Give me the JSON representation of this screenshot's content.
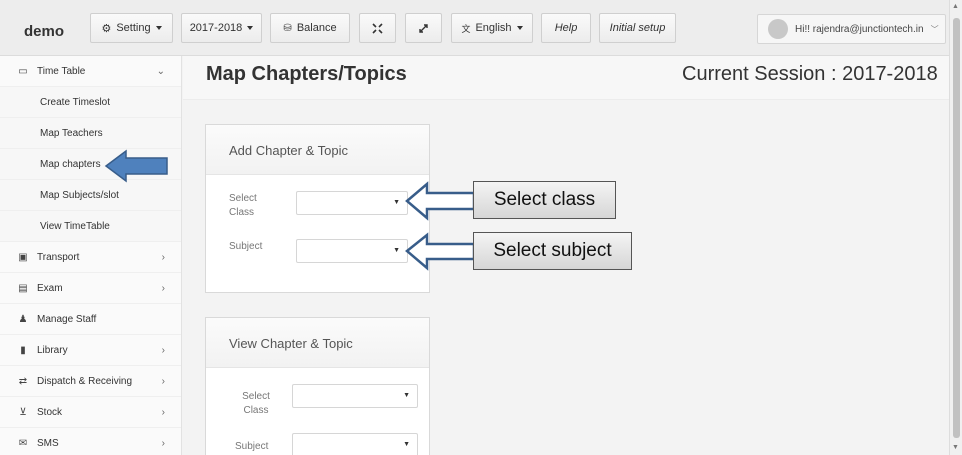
{
  "app": {
    "brand": "demo"
  },
  "toolbar": {
    "setting": "Setting",
    "year": "2017-2018",
    "balance": "Balance",
    "language": "English",
    "help": "Help",
    "initial_setup": "Initial setup",
    "user_greeting": "Hi!! rajendra@junctiontech.in"
  },
  "sidebar": {
    "items": [
      {
        "label": "Time Table",
        "icon": "calendar-icon",
        "expanded": true
      },
      {
        "label": "Create Timeslot"
      },
      {
        "label": "Map Teachers"
      },
      {
        "label": "Map chapters"
      },
      {
        "label": "Map Subjects/slot"
      },
      {
        "label": "View TimeTable"
      },
      {
        "label": "Transport",
        "icon": "bus-icon"
      },
      {
        "label": "Exam",
        "icon": "file-icon"
      },
      {
        "label": "Manage Staff",
        "icon": "users-icon"
      },
      {
        "label": "Library",
        "icon": "book-icon"
      },
      {
        "label": "Dispatch & Receiving",
        "icon": "exchange-icon"
      },
      {
        "label": "Stock",
        "icon": "cart-icon"
      },
      {
        "label": "SMS",
        "icon": "envelope-icon"
      }
    ]
  },
  "main": {
    "title": "Map Chapters/Topics",
    "session": "Current Session : 2017-2018",
    "add_panel": {
      "title": "Add Chapter & Topic",
      "class_label": "Select Class",
      "subject_label": "Subject",
      "class_value": "",
      "subject_value": ""
    },
    "view_panel": {
      "title": "View Chapter & Topic",
      "class_label": "Select Class",
      "subject_label": "Subject",
      "class_value": "",
      "subject_value": ""
    }
  },
  "annotations": {
    "select_class": "Select  class",
    "select_subject": "Select subject"
  },
  "colors": {
    "arrow_fill": "#4f81bd",
    "arrow_outline": "#385d8a"
  }
}
